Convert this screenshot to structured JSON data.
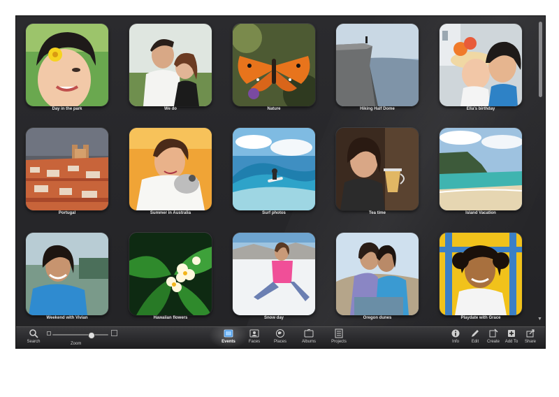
{
  "colors": {
    "background": "#2b2b2e",
    "toolbar": "#1d1d1f",
    "caption": "#e8e8e8",
    "active_icon": "#4a9be8"
  },
  "events": [
    {
      "caption": "Day in the park"
    },
    {
      "caption": "We do"
    },
    {
      "caption": "Nature"
    },
    {
      "caption": "Hiking Half Dome"
    },
    {
      "caption": "Ella's birthday"
    },
    {
      "caption": "Portugal"
    },
    {
      "caption": "Summer in Australia"
    },
    {
      "caption": "Surf photos"
    },
    {
      "caption": "Tea time"
    },
    {
      "caption": "Island Vacation"
    },
    {
      "caption": "Weekend with Vivian"
    },
    {
      "caption": "Hawaiian flowers"
    },
    {
      "caption": "Snow day"
    },
    {
      "caption": "Oregon dunes"
    },
    {
      "caption": "Playdate with Grace"
    }
  ],
  "toolbar": {
    "search": {
      "label": "Search",
      "icon": "magnifier-icon"
    },
    "zoom": {
      "label": "Zoom",
      "level": 0.7
    },
    "views": [
      {
        "label": "Events",
        "icon": "events-icon",
        "active": true
      },
      {
        "label": "Faces",
        "icon": "faces-icon"
      },
      {
        "label": "Places",
        "icon": "globe-icon"
      },
      {
        "label": "Albums",
        "icon": "albums-icon"
      },
      {
        "label": "Projects",
        "icon": "projects-icon"
      }
    ],
    "actions": [
      {
        "label": "Info",
        "icon": "info-icon"
      },
      {
        "label": "Edit",
        "icon": "pencil-icon"
      },
      {
        "label": "Create",
        "icon": "create-icon"
      },
      {
        "label": "Add To",
        "icon": "add-to-icon"
      },
      {
        "label": "Share",
        "icon": "share-icon"
      }
    ]
  }
}
